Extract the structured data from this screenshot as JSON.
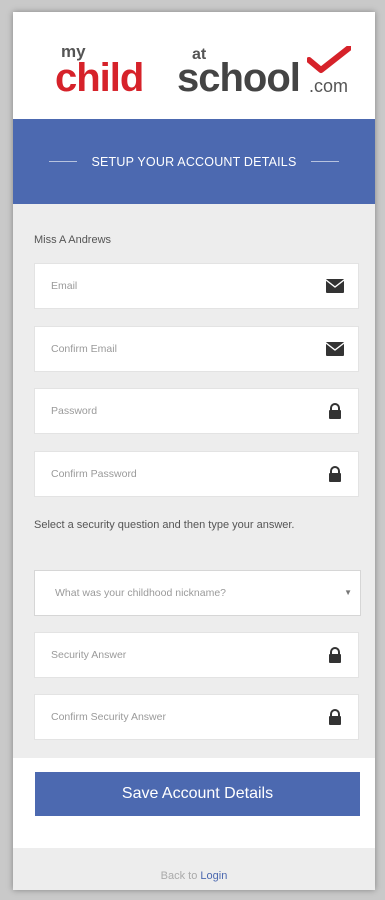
{
  "logo": {
    "my": "my",
    "child": "child",
    "at": "at",
    "school": "school",
    "com": ".com"
  },
  "header": {
    "title": "SETUP YOUR ACCOUNT DETAILS"
  },
  "user": {
    "name": "Miss A Andrews"
  },
  "form": {
    "email": {
      "placeholder": "Email",
      "icon": "envelope-icon"
    },
    "confirm_email": {
      "placeholder": "Confirm Email",
      "icon": "envelope-icon"
    },
    "password": {
      "placeholder": "Password",
      "icon": "lock-icon"
    },
    "confirm_password": {
      "placeholder": "Confirm Password",
      "icon": "lock-icon"
    },
    "instruction": "Select a security question and then type your answer.",
    "security_question": {
      "selected": "What was your childhood nickname?"
    },
    "security_answer": {
      "placeholder": "Security Answer",
      "icon": "lock-icon"
    },
    "confirm_security_answer": {
      "placeholder": "Confirm Security Answer",
      "icon": "lock-icon"
    }
  },
  "actions": {
    "save_label": "Save Account Details"
  },
  "footer": {
    "back_prefix": "Back to",
    "login_link": "Login"
  },
  "colors": {
    "primary": "#4c69b0",
    "brand_red": "#d6222a",
    "background": "#ededed"
  }
}
